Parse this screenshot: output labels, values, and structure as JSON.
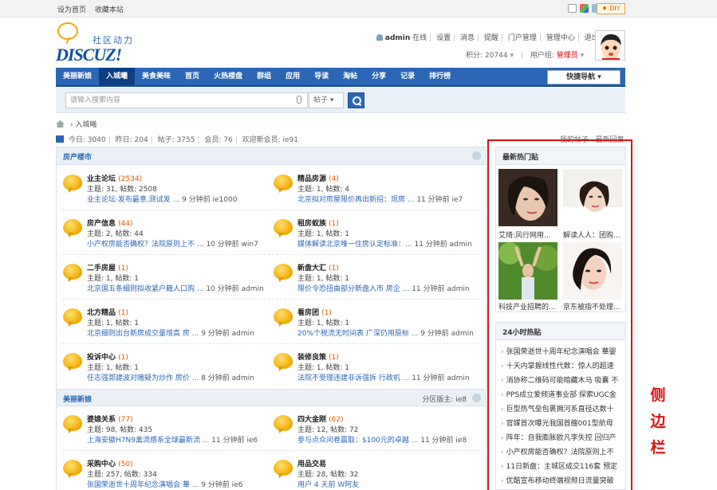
{
  "topbar": {
    "links": [
      "设为首页",
      "收藏本站"
    ],
    "diy": "♦ DIY"
  },
  "logo": {
    "cn": "社区动力",
    "en": "DISCUZ!"
  },
  "user": {
    "name": "admin",
    "status": "在线",
    "menu": [
      "设置",
      "消息",
      "提醒",
      "门户管理",
      "管理中心",
      "退出"
    ],
    "credits_label": "积分:",
    "credits": "20744",
    "group_label": "用户组:",
    "group": "管理员"
  },
  "nav": {
    "items": [
      "美丽新娘",
      "入城曦",
      "美食美味",
      "首页",
      "火热楼盘",
      "群组",
      "应用",
      "导读",
      "淘帖",
      "分享",
      "记录",
      "排行榜"
    ],
    "active_index": 1,
    "quick": "快捷导航 ▾"
  },
  "search": {
    "placeholder": "请输入搜索内容",
    "type": "帖子 ▾"
  },
  "breadcrumb": {
    "current": "入城曦",
    "sep": "›"
  },
  "stats": {
    "items": [
      "今日: 3040",
      "昨日: 204",
      "帖子: 3755",
      "会员: 76",
      "欢迎新会员: ie91"
    ],
    "right": "我的帖子 · 最新回复"
  },
  "categories": [
    {
      "title": "房产楼市",
      "moderator": "",
      "forums": [
        {
          "name": "业主论坛",
          "count": "(2534)",
          "stats": "主题: 31, 帖数: 2508",
          "link": "业主论坛·发布最意,测试发 ...",
          "time": "9 分钟前 ie1000"
        },
        {
          "name": "精品房源",
          "count": "(4)",
          "stats": "主题: 1, 帖数: 4",
          "link": "北京拟对房屋限价再出新招：现房 ...",
          "time": "11 分钟前 ie7"
        },
        {
          "name": "房产信息",
          "count": "(44)",
          "stats": "主题: 2, 帖数: 44",
          "link": "小产权房能否确权？法院原则上不 ...",
          "time": "10 分钟前 win7"
        },
        {
          "name": "租房蚁族",
          "count": "(1)",
          "stats": "主题: 1, 帖数: 1",
          "link": "媒体解读北京唯一住房认定标准：...",
          "time": "11 分钟前 admin"
        },
        {
          "name": "二手房屋",
          "count": "(1)",
          "stats": "主题: 1, 帖数: 1",
          "link": "北京国五条细则拟收紧户籍人口购 ...",
          "time": "10 分钟前 admin"
        },
        {
          "name": "新盘大汇",
          "count": "(1)",
          "stats": "主题: 1, 帖数: 1",
          "link": "限价令恐扭曲部分新盘入市 房企 ...",
          "time": "11 分钟前 admin"
        },
        {
          "name": "北方精品",
          "count": "(1)",
          "stats": "主题: 1, 帖数: 1",
          "link": "北京细则出台新房成交量增高 房 ...",
          "time": "9 分钟前 admin"
        },
        {
          "name": "看房团",
          "count": "(1)",
          "stats": "主题: 1, 帖数: 1",
          "link": "20%个税流无时间表 广深仍用原标 ...",
          "time": "9 分钟前 admin"
        },
        {
          "name": "投诉中心",
          "count": "(1)",
          "stats": "主题: 1, 帖数: 1",
          "link": "任志强郭建波对赌疑为炒作 房价 ...",
          "time": "8 分钟前 admin"
        },
        {
          "name": "装修良策",
          "count": "(1)",
          "stats": "主题: 1, 帖数: 1",
          "link": "法院不受理违建非诉强拆 行政机 ...",
          "time": "11 分钟前 admin"
        }
      ]
    },
    {
      "title": "美丽新娘",
      "moderator": "分区版主: ie8",
      "forums": [
        {
          "name": "婆媳关系",
          "count": "(77)",
          "stats": "主题: 98, 帖数: 435",
          "link": "上海安徽H7N9禽流感系全球最新流 ...",
          "time": "11 分钟前 ie6"
        },
        {
          "name": "四大金刚",
          "count": "(62)",
          "stats": "主题: 12, 帖数: 72",
          "link": "参与点众问卷赢取：$100元的卓越 ...",
          "time": "11 分钟前 ie8"
        },
        {
          "name": "采购中心",
          "count": "(50)",
          "stats": "主题: 257, 帖数: 334",
          "link": "张国荣逝世十周年纪念演唱会 華 ...",
          "time": "9 分钟前 ie6"
        },
        {
          "name": "用品交易",
          "count": "",
          "stats": "主题: 28, 帖数: 32",
          "link": "用户 4 天前 W阿友",
          "time": ""
        }
      ]
    }
  ],
  "sidebar": {
    "hot_images_title": "最新热门贴",
    "images": [
      {
        "caption": "艾琦:风行网用...",
        "icon": "portrait-photo-1"
      },
      {
        "caption": "解读人人：团购...",
        "icon": "portrait-photo-2"
      },
      {
        "caption": "科技产业招聘的...",
        "icon": "portrait-photo-3"
      },
      {
        "caption": "京东被指不处理...",
        "icon": "portrait-photo-4"
      }
    ],
    "hot_title": "24小时热贴",
    "hot_posts": [
      "张国荣逝世十周年纪念演唱会 華婴",
      "十天内掌握线性代数：惊人的超速",
      "消协称二维码可能暗藏木马 吸囊 不",
      "PPS成立爱频道事业部 探索UGC金",
      "巨型热气垒包裹拥河系直径达数十",
      "官媒首次曝光我国首艘001型航母",
      "阵年：自我膨胀欧凡李失控 回归产",
      "小产权房能否确权？法院原则上不",
      "11日新盘：主城区成交116套 预定",
      "优酷宣布移动终端视频日流量突破"
    ],
    "note": "侧边栏"
  },
  "colors": {
    "nav": "#2b66b4",
    "highlight": "#e01010",
    "count": "#e35b00"
  }
}
